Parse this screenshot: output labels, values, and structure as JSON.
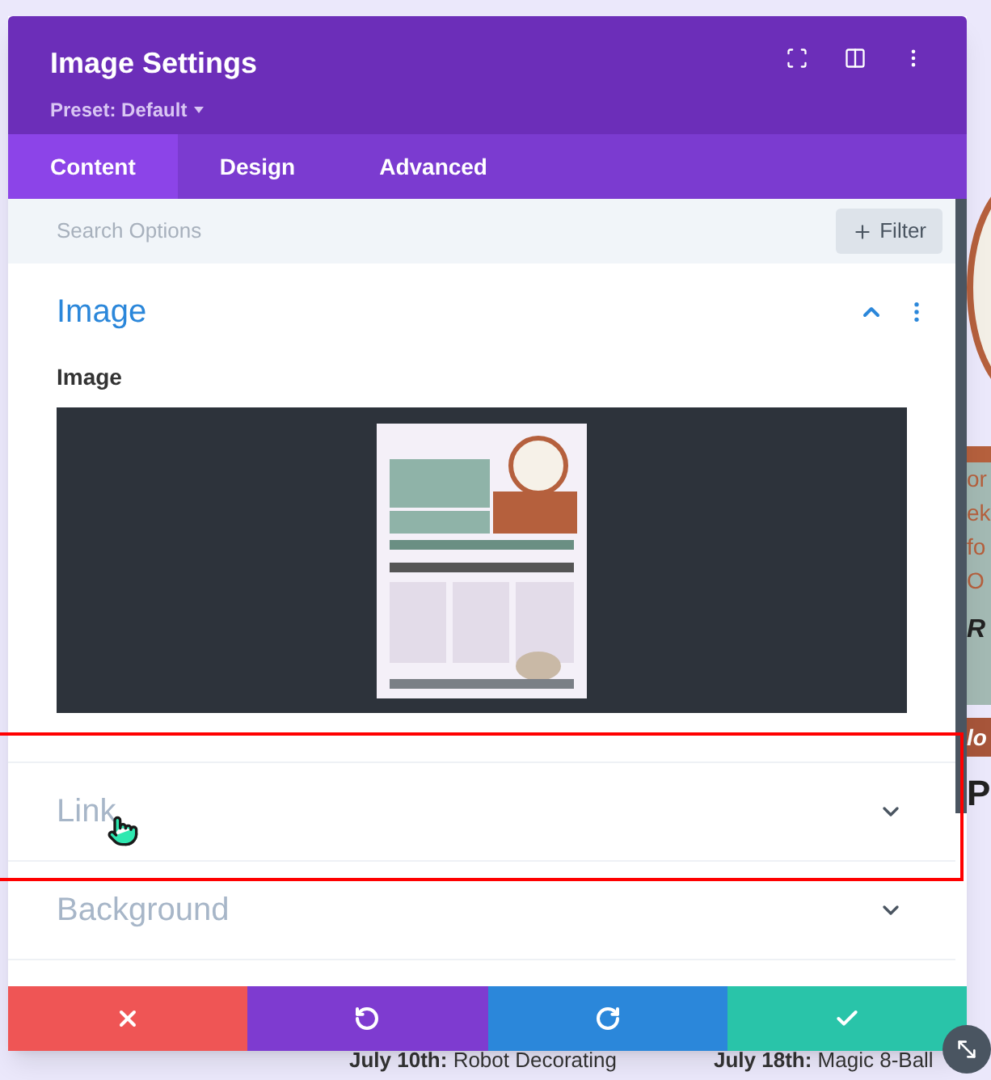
{
  "window": {
    "title": "Image Settings",
    "preset": "Preset: Default"
  },
  "tabs": [
    {
      "label": "Content",
      "selected": true
    },
    {
      "label": "Design",
      "selected": false
    },
    {
      "label": "Advanced",
      "selected": false
    }
  ],
  "search": {
    "placeholder": "Search Options",
    "filter": "Filter"
  },
  "sections": [
    {
      "title": "Image",
      "expanded": true,
      "field_label": "Image"
    },
    {
      "title": "Link",
      "expanded": false
    },
    {
      "title": "Background",
      "expanded": false
    }
  ],
  "footer_buttons": [
    {
      "kind": "cancel"
    },
    {
      "kind": "undo"
    },
    {
      "kind": "redo"
    },
    {
      "kind": "save"
    }
  ],
  "page_fragments": [
    "or",
    "ek",
    "fo",
    "O",
    "R"
  ],
  "page_banner": "lo",
  "page_heading": "P",
  "page_events": [
    {
      "date": "July 10th:",
      "name": "Robot Decorating"
    },
    {
      "date": "July 18th:",
      "name": "Magic 8-Ball"
    }
  ]
}
